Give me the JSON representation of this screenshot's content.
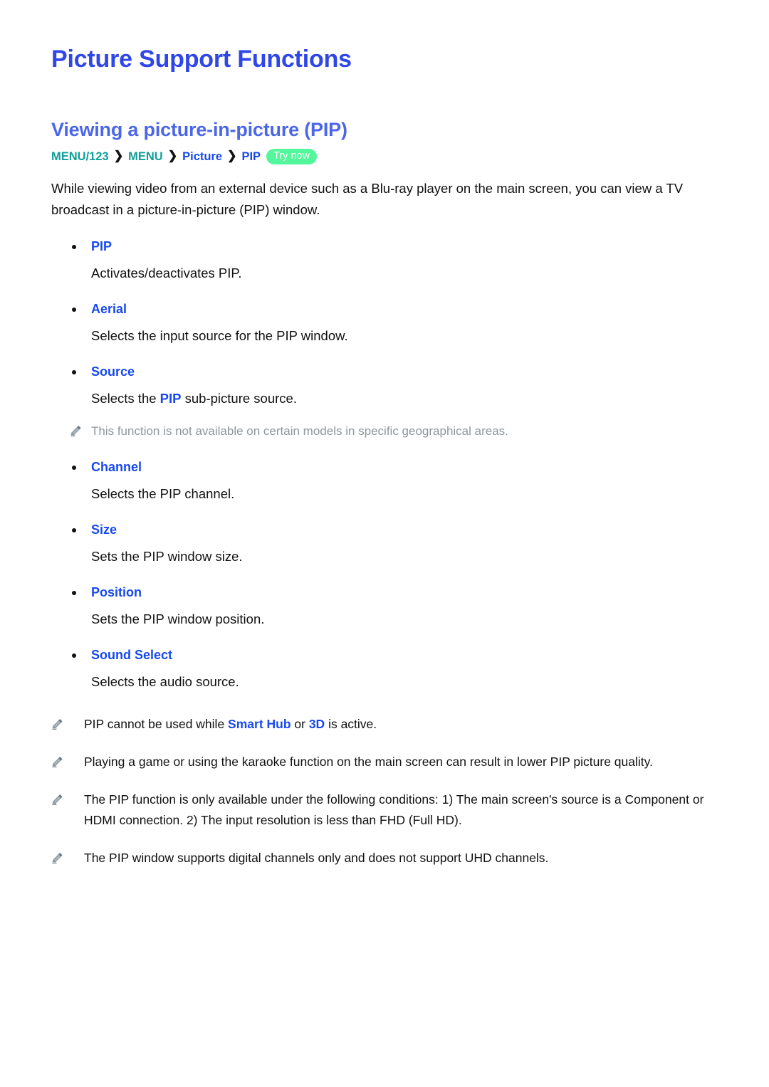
{
  "document": {
    "title": "Picture Support Functions",
    "section_title": "Viewing a picture-in-picture (PIP)"
  },
  "breadcrumb": {
    "name": "menu-path",
    "items": [
      {
        "label": "MENU/123",
        "style": "menu"
      },
      {
        "label": "MENU",
        "style": "menu"
      },
      {
        "label": "Picture",
        "style": "path"
      },
      {
        "label": "PIP",
        "style": "path"
      }
    ],
    "separator": "❯",
    "badge": "Try now"
  },
  "intro": "While viewing video from an external device such as a Blu-ray player on the main screen, you can view a TV broadcast in a picture-in-picture (PIP) window.",
  "options": [
    {
      "label": "PIP",
      "desc_prefix": "Activates/deactivates PIP.",
      "desc_highlight": "",
      "desc_suffix": "",
      "note": ""
    },
    {
      "label": "Aerial",
      "desc_prefix": "Selects the input source for the PIP window.",
      "desc_highlight": "",
      "desc_suffix": "",
      "note": ""
    },
    {
      "label": "Source",
      "desc_prefix": "Selects the ",
      "desc_highlight": "PIP",
      "desc_suffix": " sub-picture source.",
      "note": "This function is not available on certain models in specific geographical areas."
    },
    {
      "label": "Channel",
      "desc_prefix": "Selects the PIP channel.",
      "desc_highlight": "",
      "desc_suffix": "",
      "note": ""
    },
    {
      "label": "Size",
      "desc_prefix": "Sets the PIP window size.",
      "desc_highlight": "",
      "desc_suffix": "",
      "note": ""
    },
    {
      "label": "Position",
      "desc_prefix": "Sets the PIP window position.",
      "desc_highlight": "",
      "desc_suffix": "",
      "note": ""
    },
    {
      "label": "Sound Select",
      "desc_prefix": "Selects the audio source.",
      "desc_highlight": "",
      "desc_suffix": "",
      "note": ""
    }
  ],
  "notes": [
    {
      "prefix": "PIP cannot be used while ",
      "term1": "Smart Hub",
      "middle": " or ",
      "term2": "3D",
      "suffix": " is active."
    },
    {
      "prefix": "Playing a game or using the karaoke function on the main screen can result in lower PIP picture quality.",
      "term1": "",
      "middle": "",
      "term2": "",
      "suffix": ""
    },
    {
      "prefix": "The PIP function is only available under the following conditions: 1) The main screen's source is a Component or HDMI connection. 2) The input resolution is less than FHD (Full HD).",
      "term1": "",
      "middle": "",
      "term2": "",
      "suffix": ""
    },
    {
      "prefix": "The PIP window supports digital channels only and does not support UHD channels.",
      "term1": "",
      "middle": "",
      "term2": "",
      "suffix": ""
    }
  ],
  "icons": {
    "note": "pencil-icon",
    "separator": "chevron-right-icon",
    "bullet": "bullet-dot-icon"
  },
  "colors": {
    "doc_title": "#2f46e8",
    "section_title": "#4b67e8",
    "menu_teal": "#0f9e9a",
    "link_blue": "#1749ec",
    "badge_green": "#52f79b",
    "note_gray": "#8d969b",
    "body": "#111111"
  }
}
